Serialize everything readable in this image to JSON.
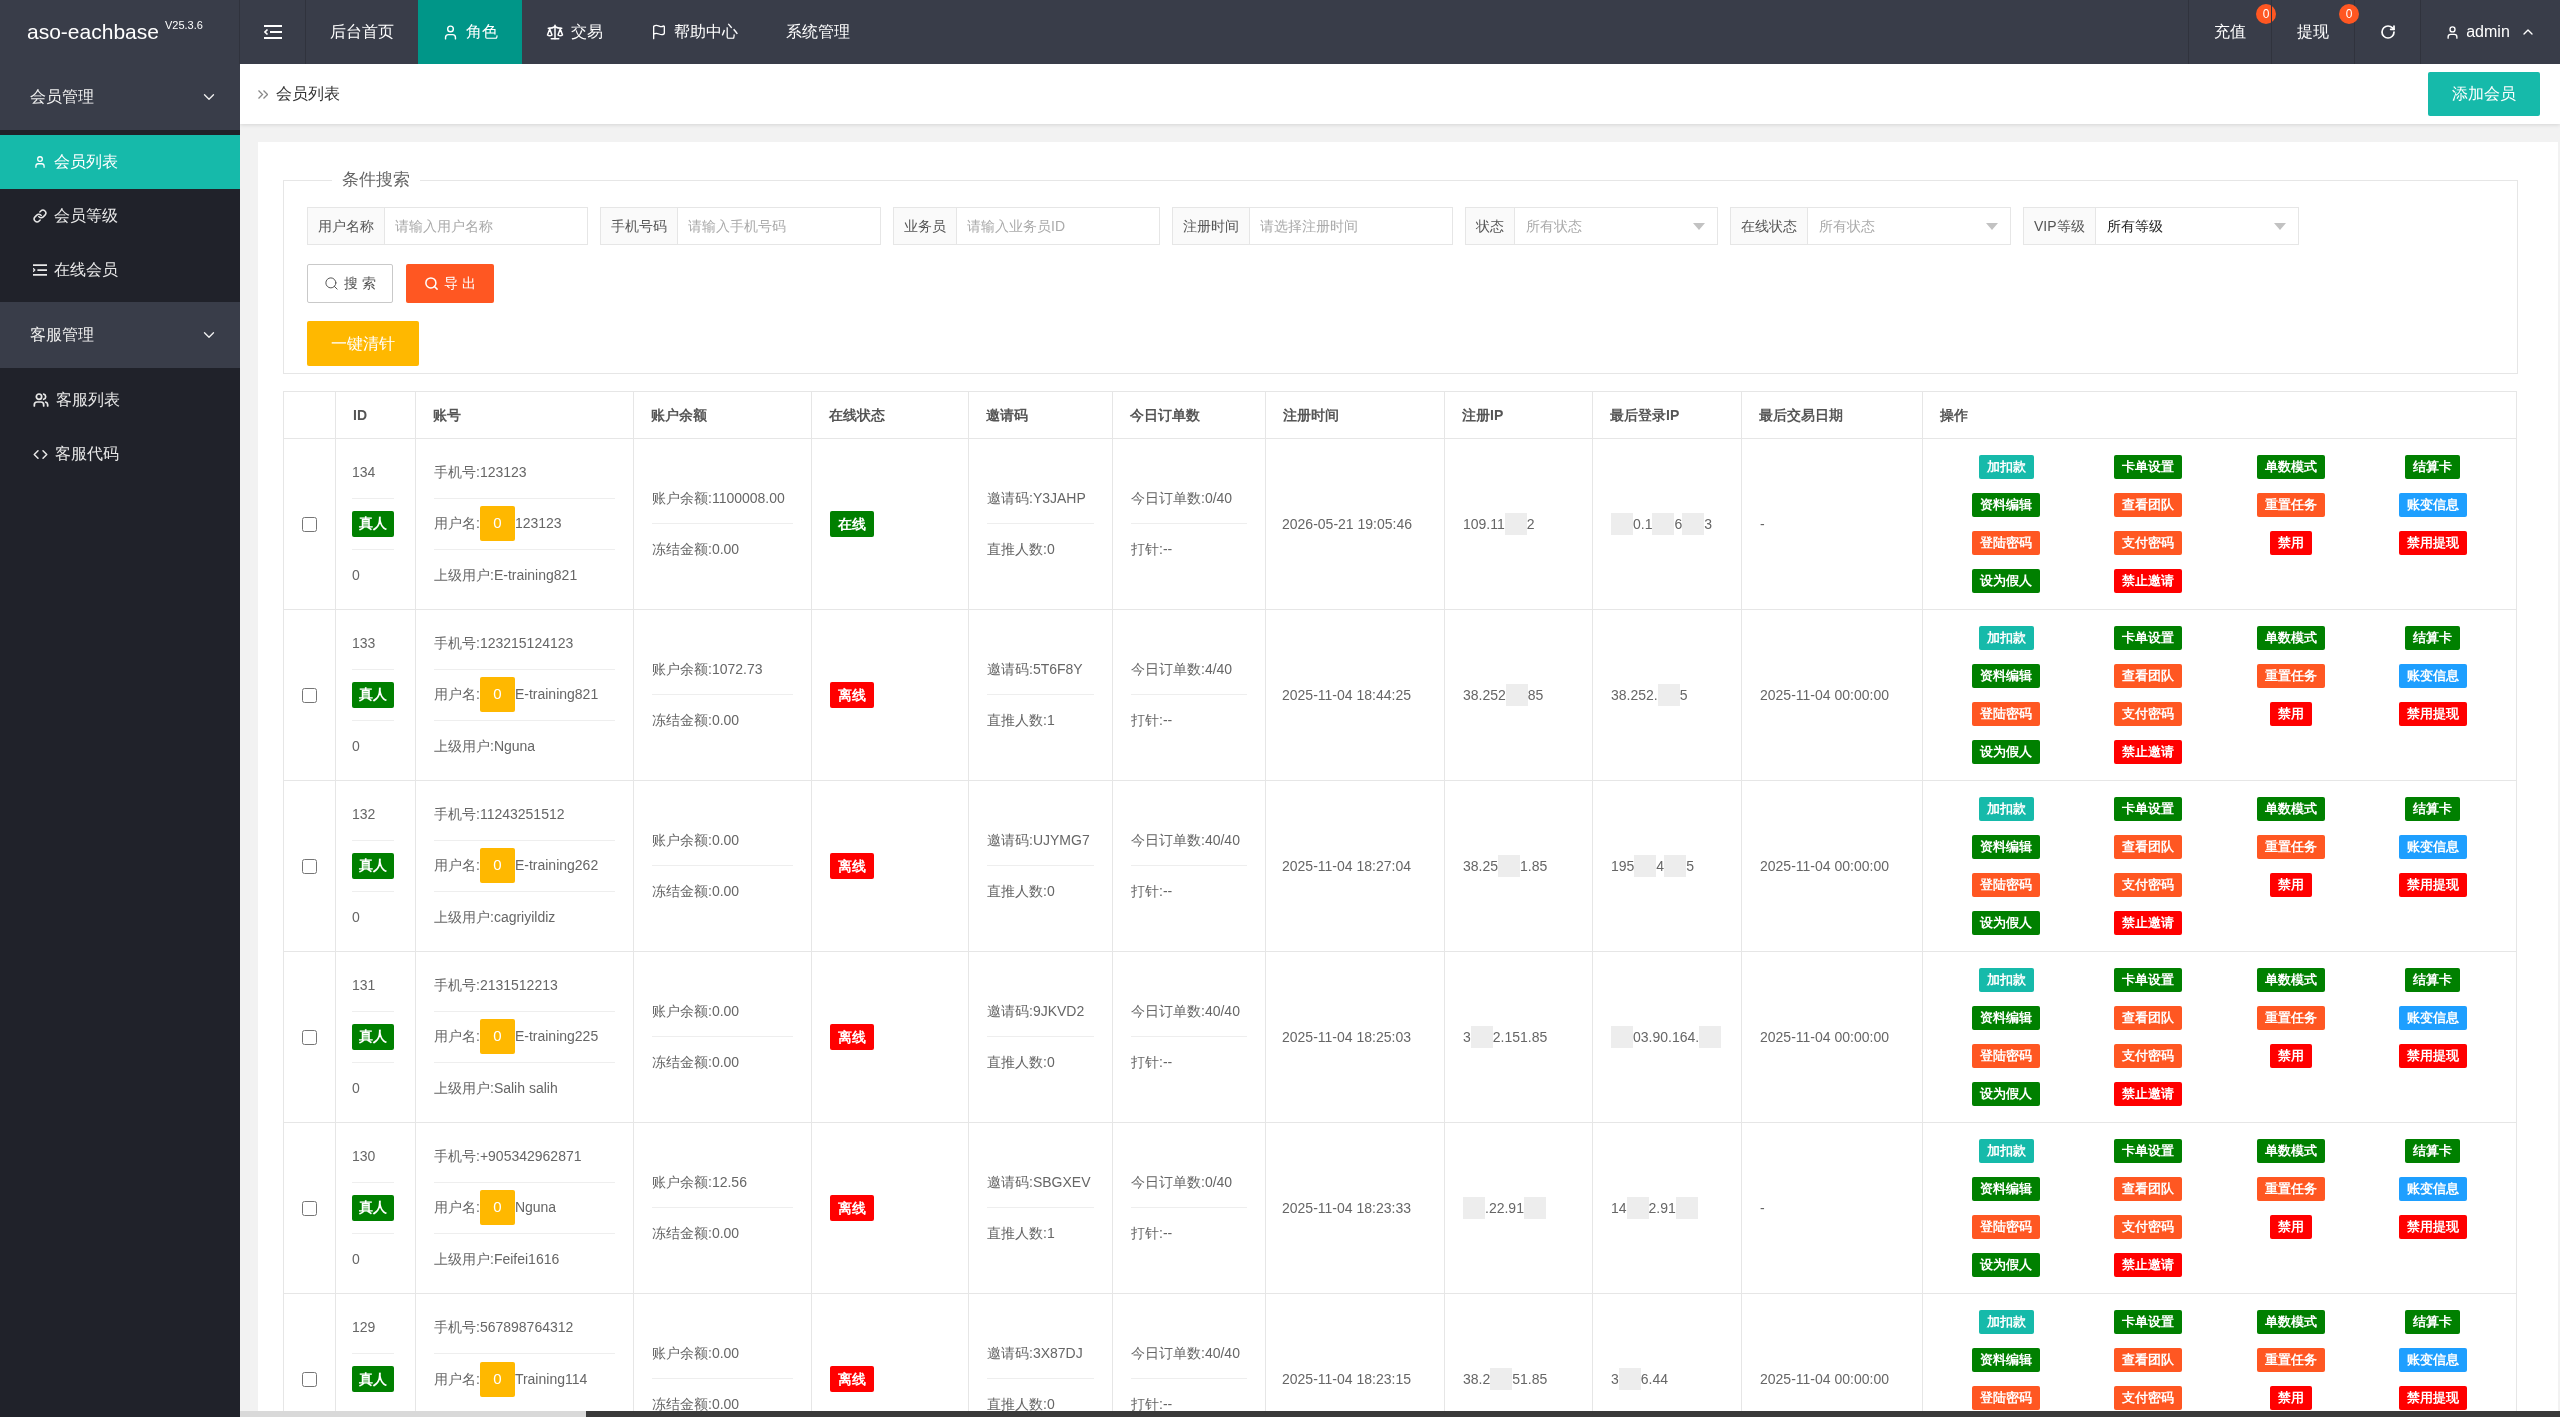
{
  "top_bar": {
    "logo": "aso-eachbase",
    "version": "V25.3.6",
    "nav": [
      {
        "label": "后台首页",
        "selected": false
      },
      {
        "label": "角色",
        "selected": true
      },
      {
        "label": "交易",
        "selected": false
      },
      {
        "label": "帮助中心",
        "selected": false
      },
      {
        "label": "系统管理",
        "selected": false
      }
    ],
    "links": [
      {
        "label": "充值",
        "badge": "0"
      },
      {
        "label": "提现",
        "badge": "0"
      }
    ],
    "user": "admin"
  },
  "sidebar": {
    "groups": [
      {
        "label": "会员管理",
        "expanded": true,
        "children": [
          {
            "label": "会员列表",
            "selected": true
          },
          {
            "label": "会员等级",
            "selected": false
          },
          {
            "label": "在线会员",
            "selected": false
          }
        ]
      },
      {
        "label": "客服管理",
        "expanded": true,
        "children": [
          {
            "label": "客服列表",
            "selected": false
          },
          {
            "label": "客服代码",
            "selected": false
          }
        ]
      }
    ]
  },
  "breadcrumb": {
    "current": "会员列表"
  },
  "add_button": "添加会员",
  "search": {
    "legend": "条件搜索",
    "fields": [
      {
        "kind": "input",
        "label": "用户名称",
        "placeholder": "请输入用户名称"
      },
      {
        "kind": "input",
        "label": "手机号码",
        "placeholder": "请输入手机号码"
      },
      {
        "kind": "input",
        "label": "业务员",
        "placeholder": "请输入业务员ID"
      },
      {
        "kind": "input",
        "label": "注册时间",
        "placeholder": "请选择注册时间"
      },
      {
        "kind": "select",
        "label": "状态",
        "placeholder": "所有状态"
      },
      {
        "kind": "select",
        "label": "在线状态",
        "placeholder": "所有状态"
      },
      {
        "kind": "select",
        "label": "VIP等级",
        "value": "所有等级"
      }
    ],
    "buttons": [
      {
        "kind": "plain",
        "label": "搜 索"
      },
      {
        "kind": "danger",
        "label": "导 出"
      }
    ],
    "bulk_button": "一键清针"
  },
  "table": {
    "columns": [
      "ID",
      "账号",
      "账户余额",
      "在线状态",
      "邀请码",
      "今日订单数",
      "注册时间",
      "注册IP",
      "最后登录IP",
      "最后交易日期",
      "操作"
    ],
    "rows": [
      {
        "checked": false,
        "id": "134",
        "type": "真人",
        "sub_value": "0",
        "account": {
          "phone": "手机号:123123",
          "username_label": "用户名:",
          "badge": "0",
          "username": "123123",
          "parent": "上级用户:E-training821"
        },
        "balance": "账户余额:1100008.00",
        "frozen": "冻结金额:0.00",
        "status": {
          "text": "在线",
          "online": true
        },
        "invite": "邀请码:Y3JAHP",
        "referrals": "直推人数:0",
        "orders": "今日订单数:0/40",
        "injection": "打针:--",
        "reg_time": "2026-05-21 19:05:46",
        "reg_ip": [
          {
            "kind": "text",
            "text": "109.11"
          },
          {
            "kind": "redacted"
          },
          {
            "kind": "text",
            "text": "2"
          }
        ],
        "last_ip": [
          {
            "kind": "redacted"
          },
          {
            "kind": "text",
            "text": "0.1"
          },
          {
            "kind": "redacted"
          },
          {
            "kind": "text",
            "text": "6"
          },
          {
            "kind": "redacted"
          },
          {
            "kind": "text",
            "text": "3"
          }
        ],
        "last_trade": "-",
        "actions": [
          {
            "label": "加扣款",
            "color": "#16baaa"
          },
          {
            "label": "卡单设置",
            "color": "#008000"
          },
          {
            "label": "单数模式",
            "color": "#008000"
          },
          {
            "label": "结算卡",
            "color": "#008000"
          },
          {
            "label": "资料编辑",
            "color": "#008000"
          },
          {
            "label": "查看团队",
            "color": "#ff5722"
          },
          {
            "label": "重置任务",
            "color": "#ff5722"
          },
          {
            "label": "账变信息",
            "color": "#1e9fff"
          },
          {
            "label": "登陆密码",
            "color": "#ff5722"
          },
          {
            "label": "支付密码",
            "color": "#ff5722"
          },
          {
            "label": "禁用",
            "color": "#ff0000"
          },
          {
            "label": "禁用提现",
            "color": "#ff0000"
          },
          {
            "label": "设为假人",
            "color": "#008000"
          },
          {
            "label": "禁止邀请",
            "color": "#ff0000"
          }
        ]
      },
      {
        "checked": false,
        "id": "133",
        "type": "真人",
        "sub_value": "0",
        "account": {
          "phone": "手机号:123215124123",
          "username_label": "用户名:",
          "badge": "0",
          "username": "E-training821",
          "parent": "上级用户:Nguna"
        },
        "balance": "账户余额:1072.73",
        "frozen": "冻结金额:0.00",
        "status": {
          "text": "离线",
          "online": false
        },
        "invite": "邀请码:5T6F8Y",
        "referrals": "直推人数:1",
        "orders": "今日订单数:4/40",
        "injection": "打针:--",
        "reg_time": "2025-11-04 18:44:25",
        "reg_ip": [
          {
            "kind": "text",
            "text": "38.252"
          },
          {
            "kind": "redacted"
          },
          {
            "kind": "text",
            "text": "85"
          }
        ],
        "last_ip": [
          {
            "kind": "text",
            "text": "38.252."
          },
          {
            "kind": "redacted"
          },
          {
            "kind": "text",
            "text": "5"
          }
        ],
        "last_trade": "2025-11-04 00:00:00",
        "actions": [
          {
            "label": "加扣款",
            "color": "#16baaa"
          },
          {
            "label": "卡单设置",
            "color": "#008000"
          },
          {
            "label": "单数模式",
            "color": "#008000"
          },
          {
            "label": "结算卡",
            "color": "#008000"
          },
          {
            "label": "资料编辑",
            "color": "#008000"
          },
          {
            "label": "查看团队",
            "color": "#ff5722"
          },
          {
            "label": "重置任务",
            "color": "#ff5722"
          },
          {
            "label": "账变信息",
            "color": "#1e9fff"
          },
          {
            "label": "登陆密码",
            "color": "#ff5722"
          },
          {
            "label": "支付密码",
            "color": "#ff5722"
          },
          {
            "label": "禁用",
            "color": "#ff0000"
          },
          {
            "label": "禁用提现",
            "color": "#ff0000"
          },
          {
            "label": "设为假人",
            "color": "#008000"
          },
          {
            "label": "禁止邀请",
            "color": "#ff0000"
          }
        ]
      },
      {
        "checked": false,
        "id": "132",
        "type": "真人",
        "sub_value": "0",
        "account": {
          "phone": "手机号:11243251512",
          "username_label": "用户名:",
          "badge": "0",
          "username": "E-training262",
          "parent": "上级用户:cagriyildiz"
        },
        "balance": "账户余额:0.00",
        "frozen": "冻结金额:0.00",
        "status": {
          "text": "离线",
          "online": false
        },
        "invite": "邀请码:UJYMG7",
        "referrals": "直推人数:0",
        "orders": "今日订单数:40/40",
        "injection": "打针:--",
        "reg_time": "2025-11-04 18:27:04",
        "reg_ip": [
          {
            "kind": "text",
            "text": "38.25"
          },
          {
            "kind": "redacted"
          },
          {
            "kind": "text",
            "text": "1.85"
          }
        ],
        "last_ip": [
          {
            "kind": "text",
            "text": "195"
          },
          {
            "kind": "redacted"
          },
          {
            "kind": "text",
            "text": "4"
          },
          {
            "kind": "redacted"
          },
          {
            "kind": "text",
            "text": "5"
          }
        ],
        "last_trade": "2025-11-04 00:00:00",
        "actions": [
          {
            "label": "加扣款",
            "color": "#16baaa"
          },
          {
            "label": "卡单设置",
            "color": "#008000"
          },
          {
            "label": "单数模式",
            "color": "#008000"
          },
          {
            "label": "结算卡",
            "color": "#008000"
          },
          {
            "label": "资料编辑",
            "color": "#008000"
          },
          {
            "label": "查看团队",
            "color": "#ff5722"
          },
          {
            "label": "重置任务",
            "color": "#ff5722"
          },
          {
            "label": "账变信息",
            "color": "#1e9fff"
          },
          {
            "label": "登陆密码",
            "color": "#ff5722"
          },
          {
            "label": "支付密码",
            "color": "#ff5722"
          },
          {
            "label": "禁用",
            "color": "#ff0000"
          },
          {
            "label": "禁用提现",
            "color": "#ff0000"
          },
          {
            "label": "设为假人",
            "color": "#008000"
          },
          {
            "label": "禁止邀请",
            "color": "#ff0000"
          }
        ]
      },
      {
        "checked": false,
        "id": "131",
        "type": "真人",
        "sub_value": "0",
        "account": {
          "phone": "手机号:2131512213",
          "username_label": "用户名:",
          "badge": "0",
          "username": "E-training225",
          "parent": "上级用户:Salih salih"
        },
        "balance": "账户余额:0.00",
        "frozen": "冻结金额:0.00",
        "status": {
          "text": "离线",
          "online": false
        },
        "invite": "邀请码:9JKVD2",
        "referrals": "直推人数:0",
        "orders": "今日订单数:40/40",
        "injection": "打针:--",
        "reg_time": "2025-11-04 18:25:03",
        "reg_ip": [
          {
            "kind": "text",
            "text": "3"
          },
          {
            "kind": "redacted"
          },
          {
            "kind": "text",
            "text": "2.151.85"
          }
        ],
        "last_ip": [
          {
            "kind": "redacted"
          },
          {
            "kind": "text",
            "text": "03.90.164."
          },
          {
            "kind": "redacted"
          }
        ],
        "last_trade": "2025-11-04 00:00:00",
        "actions": [
          {
            "label": "加扣款",
            "color": "#16baaa"
          },
          {
            "label": "卡单设置",
            "color": "#008000"
          },
          {
            "label": "单数模式",
            "color": "#008000"
          },
          {
            "label": "结算卡",
            "color": "#008000"
          },
          {
            "label": "资料编辑",
            "color": "#008000"
          },
          {
            "label": "查看团队",
            "color": "#ff5722"
          },
          {
            "label": "重置任务",
            "color": "#ff5722"
          },
          {
            "label": "账变信息",
            "color": "#1e9fff"
          },
          {
            "label": "登陆密码",
            "color": "#ff5722"
          },
          {
            "label": "支付密码",
            "color": "#ff5722"
          },
          {
            "label": "禁用",
            "color": "#ff0000"
          },
          {
            "label": "禁用提现",
            "color": "#ff0000"
          },
          {
            "label": "设为假人",
            "color": "#008000"
          },
          {
            "label": "禁止邀请",
            "color": "#ff0000"
          }
        ]
      },
      {
        "checked": false,
        "id": "130",
        "type": "真人",
        "sub_value": "0",
        "account": {
          "phone": "手机号:+905342962871",
          "username_label": "用户名:",
          "badge": "0",
          "username": "Nguna",
          "parent": "上级用户:Feifei1616"
        },
        "balance": "账户余额:12.56",
        "frozen": "冻结金额:0.00",
        "status": {
          "text": "离线",
          "online": false
        },
        "invite": "邀请码:SBGXEV",
        "referrals": "直推人数:1",
        "orders": "今日订单数:0/40",
        "injection": "打针:--",
        "reg_time": "2025-11-04 18:23:33",
        "reg_ip": [
          {
            "kind": "redacted"
          },
          {
            "kind": "text",
            "text": ".22.91"
          },
          {
            "kind": "redacted"
          }
        ],
        "last_ip": [
          {
            "kind": "text",
            "text": "14"
          },
          {
            "kind": "redacted"
          },
          {
            "kind": "text",
            "text": "2.91"
          },
          {
            "kind": "redacted"
          }
        ],
        "last_trade": "-",
        "actions": [
          {
            "label": "加扣款",
            "color": "#16baaa"
          },
          {
            "label": "卡单设置",
            "color": "#008000"
          },
          {
            "label": "单数模式",
            "color": "#008000"
          },
          {
            "label": "结算卡",
            "color": "#008000"
          },
          {
            "label": "资料编辑",
            "color": "#008000"
          },
          {
            "label": "查看团队",
            "color": "#ff5722"
          },
          {
            "label": "重置任务",
            "color": "#ff5722"
          },
          {
            "label": "账变信息",
            "color": "#1e9fff"
          },
          {
            "label": "登陆密码",
            "color": "#ff5722"
          },
          {
            "label": "支付密码",
            "color": "#ff5722"
          },
          {
            "label": "禁用",
            "color": "#ff0000"
          },
          {
            "label": "禁用提现",
            "color": "#ff0000"
          },
          {
            "label": "设为假人",
            "color": "#008000"
          },
          {
            "label": "禁止邀请",
            "color": "#ff0000"
          }
        ]
      },
      {
        "checked": false,
        "id": "129",
        "type": "真人",
        "account": {
          "phone": "手机号:567898764312",
          "username_label": "用户名:",
          "badge": "0",
          "username": "Training114"
        },
        "balance": "账户余额:0.00",
        "frozen": "冻结金额:0.00",
        "status": {
          "text": "离线",
          "online": false
        },
        "invite": "邀请码:3X87DJ",
        "referrals": "直推人数:0",
        "orders": "今日订单数:40/40",
        "injection": "打针:--",
        "reg_time": "2025-11-04 18:23:15",
        "reg_ip": [
          {
            "kind": "text",
            "text": "38.2"
          },
          {
            "kind": "redacted"
          },
          {
            "kind": "text",
            "text": "51.85"
          }
        ],
        "last_ip": [
          {
            "kind": "text",
            "text": "3"
          },
          {
            "kind": "redacted"
          },
          {
            "kind": "text",
            "text": "6.44"
          }
        ],
        "last_trade": "2025-11-04 00:00:00",
        "actions": [
          {
            "label": "加扣款",
            "color": "#16baaa"
          },
          {
            "label": "卡单设置",
            "color": "#008000"
          },
          {
            "label": "单数模式",
            "color": "#008000"
          },
          {
            "label": "结算卡",
            "color": "#008000"
          },
          {
            "label": "资料编辑",
            "color": "#008000"
          },
          {
            "label": "查看团队",
            "color": "#ff5722"
          },
          {
            "label": "重置任务",
            "color": "#ff5722"
          },
          {
            "label": "账变信息",
            "color": "#1e9fff"
          },
          {
            "label": "登陆密码",
            "color": "#ff5722"
          },
          {
            "label": "支付密码",
            "color": "#ff5722"
          },
          {
            "label": "禁用",
            "color": "#ff0000"
          },
          {
            "label": "禁用提现",
            "color": "#ff0000"
          }
        ]
      }
    ]
  }
}
